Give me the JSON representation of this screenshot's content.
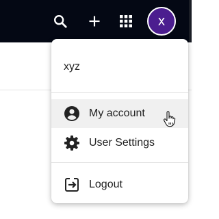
{
  "header": {
    "icons": [
      "search-icon",
      "plus-icon",
      "apps-grid-icon"
    ],
    "avatar_initial": "x",
    "colors": {
      "topbar": "#040814",
      "avatar": "#4b1d8f"
    }
  },
  "user_menu": {
    "username": "xyz",
    "items": [
      {
        "label": "My account",
        "icon": "account-circle-icon",
        "hovered": true
      },
      {
        "label": "User Settings",
        "icon": "gear-icon"
      },
      {
        "label": "Logout",
        "icon": "logout-icon"
      }
    ]
  }
}
